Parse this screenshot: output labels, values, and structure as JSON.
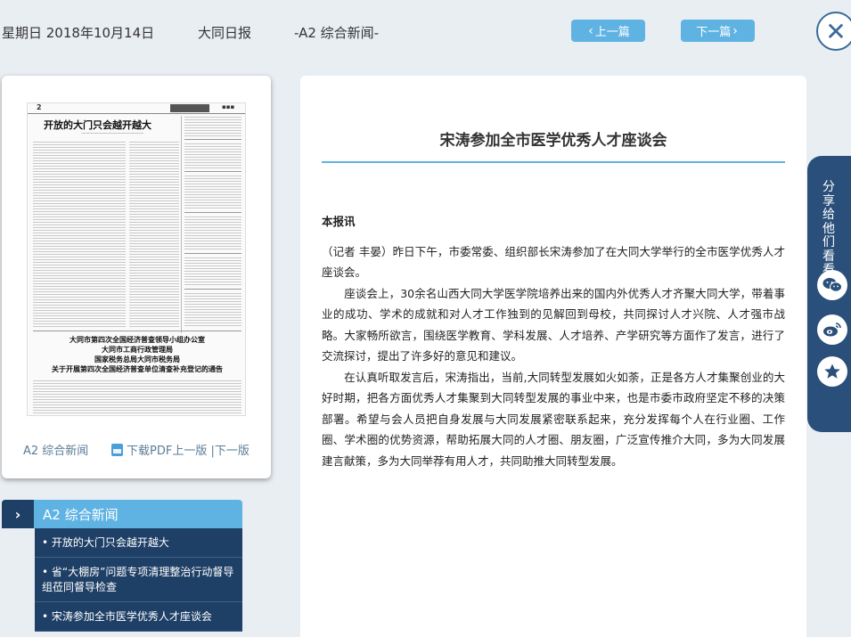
{
  "header": {
    "date": "星期日 2018年10月14日",
    "paper_name": "大同日报",
    "edition": "-A2 综合新闻-",
    "prev_label": "上一篇",
    "next_label": "下一篇"
  },
  "thumbnail": {
    "page_number": "2",
    "headline": "开放的大门只会越开越大",
    "bottom_notice": [
      "大同市第四次全国经济普查领导小组办公室",
      "大同市工商行政管理局",
      "国家税务总局大同市税务局",
      "关于开展第四次全国经济普查单位清查补充登记的通告"
    ],
    "edition_label": "A2 综合新闻",
    "pdf_label": "下载PDF",
    "pager_label": "上一版 |下一版"
  },
  "edition_panel": {
    "title": "A2  综合新闻",
    "items": [
      "• 开放的大门只会越开越大",
      "• 省“大棚房”问题专项清理整治行动督导组莅同督导检查",
      "• 宋涛参加全市医学优秀人才座谈会"
    ]
  },
  "article": {
    "title": "宋涛参加全市医学优秀人才座谈会",
    "lead": "本报讯",
    "paragraphs": [
      "（记者 丰晏）昨日下午，市委常委、组织部长宋涛参加了在大同大学举行的全市医学优秀人才座谈会。",
      "　　座谈会上，30余名山西大同大学医学院培养出来的国内外优秀人才齐聚大同大学，带着事业的成功、学术的成就和对人才工作独到的见解回到母校，共同探讨人才兴院、人才强市战略。大家畅所欲言，围绕医学教育、学科发展、人才培养、产学研究等方面作了发言，进行了交流探讨，提出了许多好的意见和建议。",
      "　　在认真听取发言后，宋涛指出，当前,大同转型发展如火如荼，正是各方人才集聚创业的大好时期，把各方面优秀人才集聚到大同转型发展的事业中来，也是市委市政府坚定不移的决策部署。希望与会人员把自身发展与大同发展紧密联系起来，充分发挥每个人在行业圈、工作圈、学术圈的优势资源，帮助拓展大同的人才圈、朋友圈，广泛宣传推介大同，多为大同发展建言献策，多为大同举荐有用人才，共同助推大同转型发展。"
    ]
  },
  "share": {
    "label": "分享给他们看看"
  }
}
